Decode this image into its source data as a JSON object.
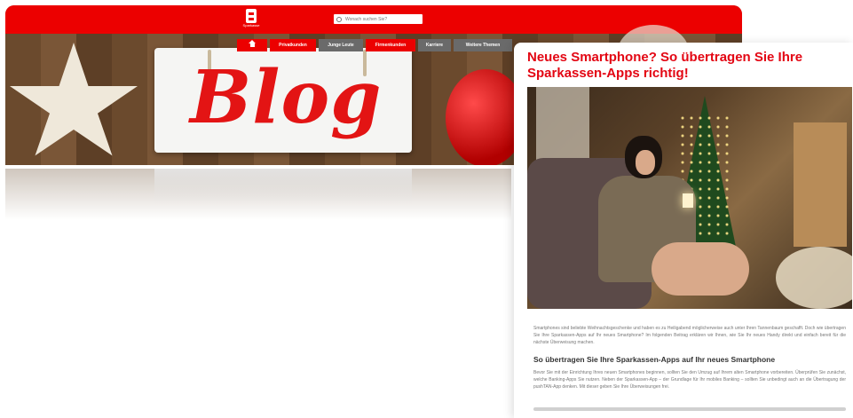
{
  "brand": {
    "caption": "Sparkasse"
  },
  "search": {
    "placeholder": "Wonach suchen Sie?"
  },
  "nav": {
    "home_icon": "home-icon",
    "items": [
      {
        "label": "Privatkunden",
        "color": "#ec0000"
      },
      {
        "label": "Junge Leute",
        "color": "#6a6a6a"
      },
      {
        "label": "Firmenkunden",
        "color": "#ec0000"
      },
      {
        "label": "Karriere",
        "color": "#6a6a6a"
      },
      {
        "label": "Weitere Themen",
        "color": "#6a6a6a"
      }
    ]
  },
  "hero": {
    "sign_text": "Blog"
  },
  "article": {
    "title": "Neues Smartphone? So übertragen Sie Ihre Sparkassen-Apps richtig!",
    "intro": "Smartphones sind beliebte Weihnachtsgeschenke und haben es zu Heiligabend möglicherweise auch unter Ihren Tannenbaum geschafft. Doch wie übertragen Sie Ihre Sparkassen-Apps auf Ihr neues Smartphone? Im folgenden Beitrag erklären wir Ihnen, wie Sie Ihr neues Handy direkt und einfach bereit für die nächste Überweisung machen.",
    "subheading": "So übertragen Sie Ihre Sparkassen-Apps auf Ihr neues Smartphone",
    "paragraph": "Bevor Sie mit der Einrichtung Ihres neuen Smartphones beginnen, sollten Sie den Umzug auf Ihrem alten Smartphone vorbereiten. Überprüfen Sie zunächst, welche Banking-Apps Sie nutzen. Neben der Sparkassen-App – der Grundlage für Ihr mobiles Banking – sollten Sie unbedingt auch an die Übertragung der pushTAN-App denken. Mit dieser geben Sie Ihre Überweisungen frei."
  },
  "colors": {
    "brand_red": "#ec0000",
    "title_red": "#e30613"
  }
}
